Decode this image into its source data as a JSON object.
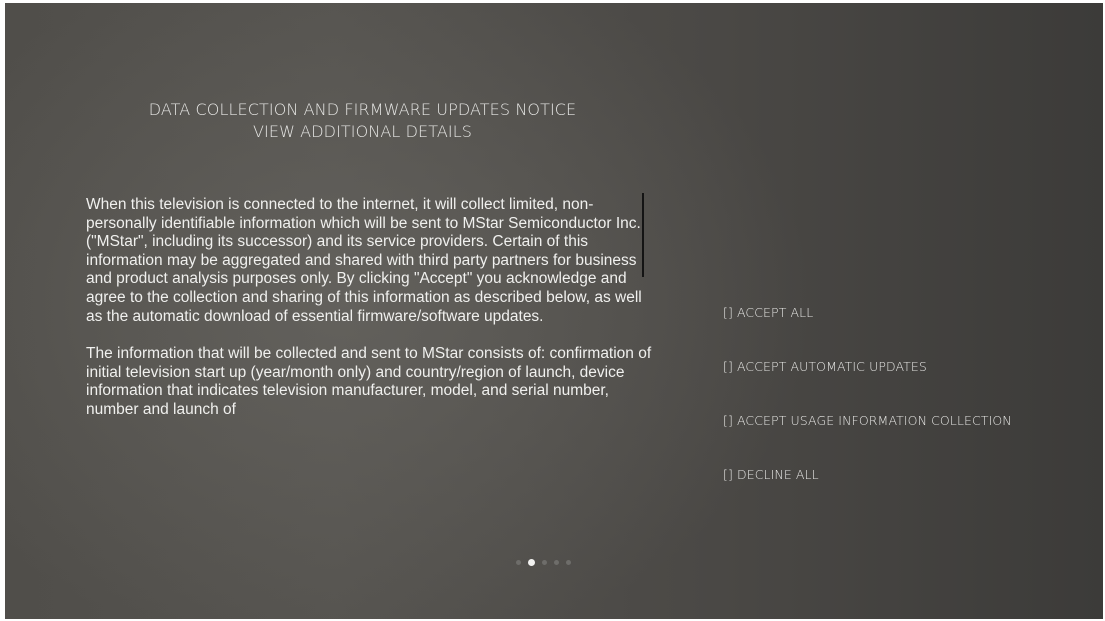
{
  "header": {
    "title": "DATA COLLECTION AND FIRMWARE UPDATES NOTICE",
    "details_link": "VIEW ADDITIONAL DETAILS"
  },
  "body": {
    "paragraphs": [
      "When this television is connected to the internet, it will collect limited, non-personally identifiable information which will be sent to MStar Semiconductor Inc. (\"MStar\", including its successor) and its service providers. Certain of this information may be aggregated and shared with third party partners for business and product analysis purposes only. By clicking \"Accept\" you acknowledge and agree to the collection and sharing of this information as described below, as well as the automatic download of essential firmware/software updates.",
      "The information that will be collected and sent to MStar consists of: confirmation of initial television start up (year/month only) and country/region of launch, device information that indicates television manufacturer, model, and serial number, number and launch of"
    ]
  },
  "options": [
    {
      "checkbox": "[]",
      "label": "ACCEPT ALL"
    },
    {
      "checkbox": "[]",
      "label": "ACCEPT AUTOMATIC UPDATES"
    },
    {
      "checkbox": "[]",
      "label": "ACCEPT USAGE INFORMATION COLLECTION"
    },
    {
      "checkbox": "[]",
      "label": "DECLINE ALL"
    }
  ],
  "pager": {
    "total_pages": 5,
    "current_page": 2
  },
  "colors": {
    "text": "#f0f0ee",
    "active_dot": "#f2f2f0",
    "inactive_dot": "#6e6d6a"
  }
}
